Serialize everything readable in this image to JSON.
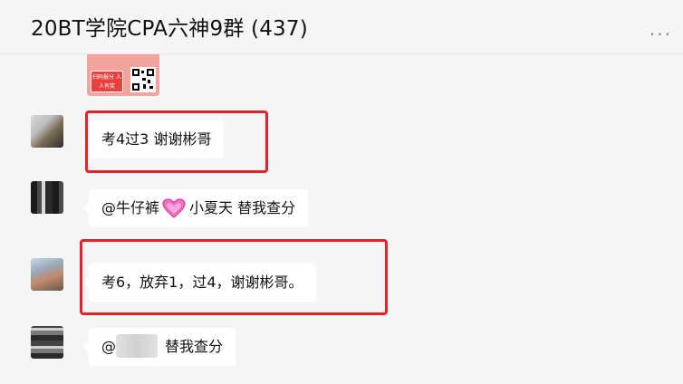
{
  "header": {
    "title": "20BT学院CPA六神9群 (437)",
    "more_label": "..."
  },
  "image_message": {
    "tag_text": "扫码报分 人人有奖"
  },
  "messages": [
    {
      "avatar": "avatar-blurred",
      "text": "考4过3 谢谢彬哥"
    },
    {
      "avatar": "avatar-blurred",
      "mention": "@牛仔裤",
      "emoji": "pink-heart",
      "text": "小夏天 替我查分"
    },
    {
      "avatar": "avatar-blurred",
      "text": "考6，放弃1，过4，谢谢彬哥。"
    },
    {
      "avatar": "avatar-blurred",
      "mention": "@",
      "text": "替我查分"
    }
  ],
  "colors": {
    "background": "#f5f5f5",
    "bubble": "#ffffff",
    "highlight_border": "#e8202a"
  }
}
